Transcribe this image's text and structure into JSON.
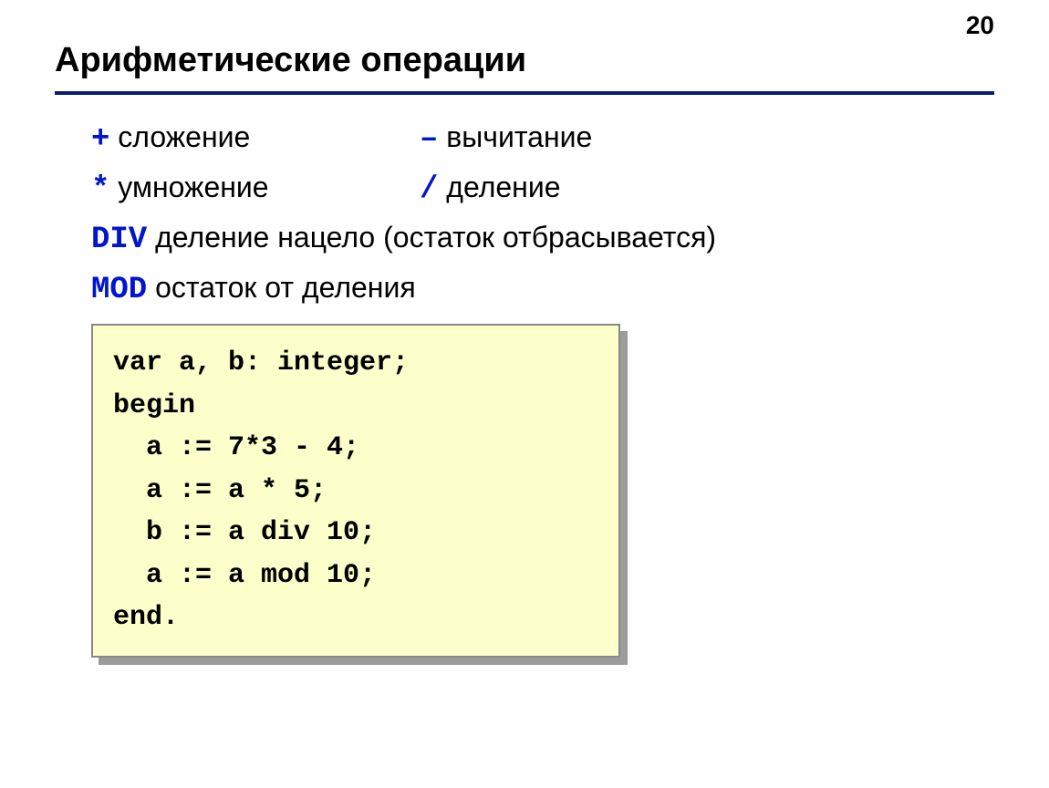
{
  "page_number": "20",
  "title": "Арифметические операции",
  "operations": {
    "plus_sym": "+",
    "plus_label": " сложение",
    "minus_sym": "–",
    "minus_label": " вычитание",
    "mul_sym": "*",
    "mul_label": " умножение",
    "div_sym": "/",
    "div_label": " деление",
    "divkw_sym": "DIV",
    "divkw_label": " деление нацело (остаток отбрасывается)",
    "modkw_sym": "MOD",
    "modkw_label": " остаток от деления"
  },
  "code": {
    "l1": "var a, b: integer;",
    "l2": "begin",
    "l3": "  a := 7*3 - 4;",
    "l4": "  a := a * 5;",
    "l5": "  b := a div 10;",
    "l6": "  a := a mod 10;",
    "l7": "end."
  }
}
